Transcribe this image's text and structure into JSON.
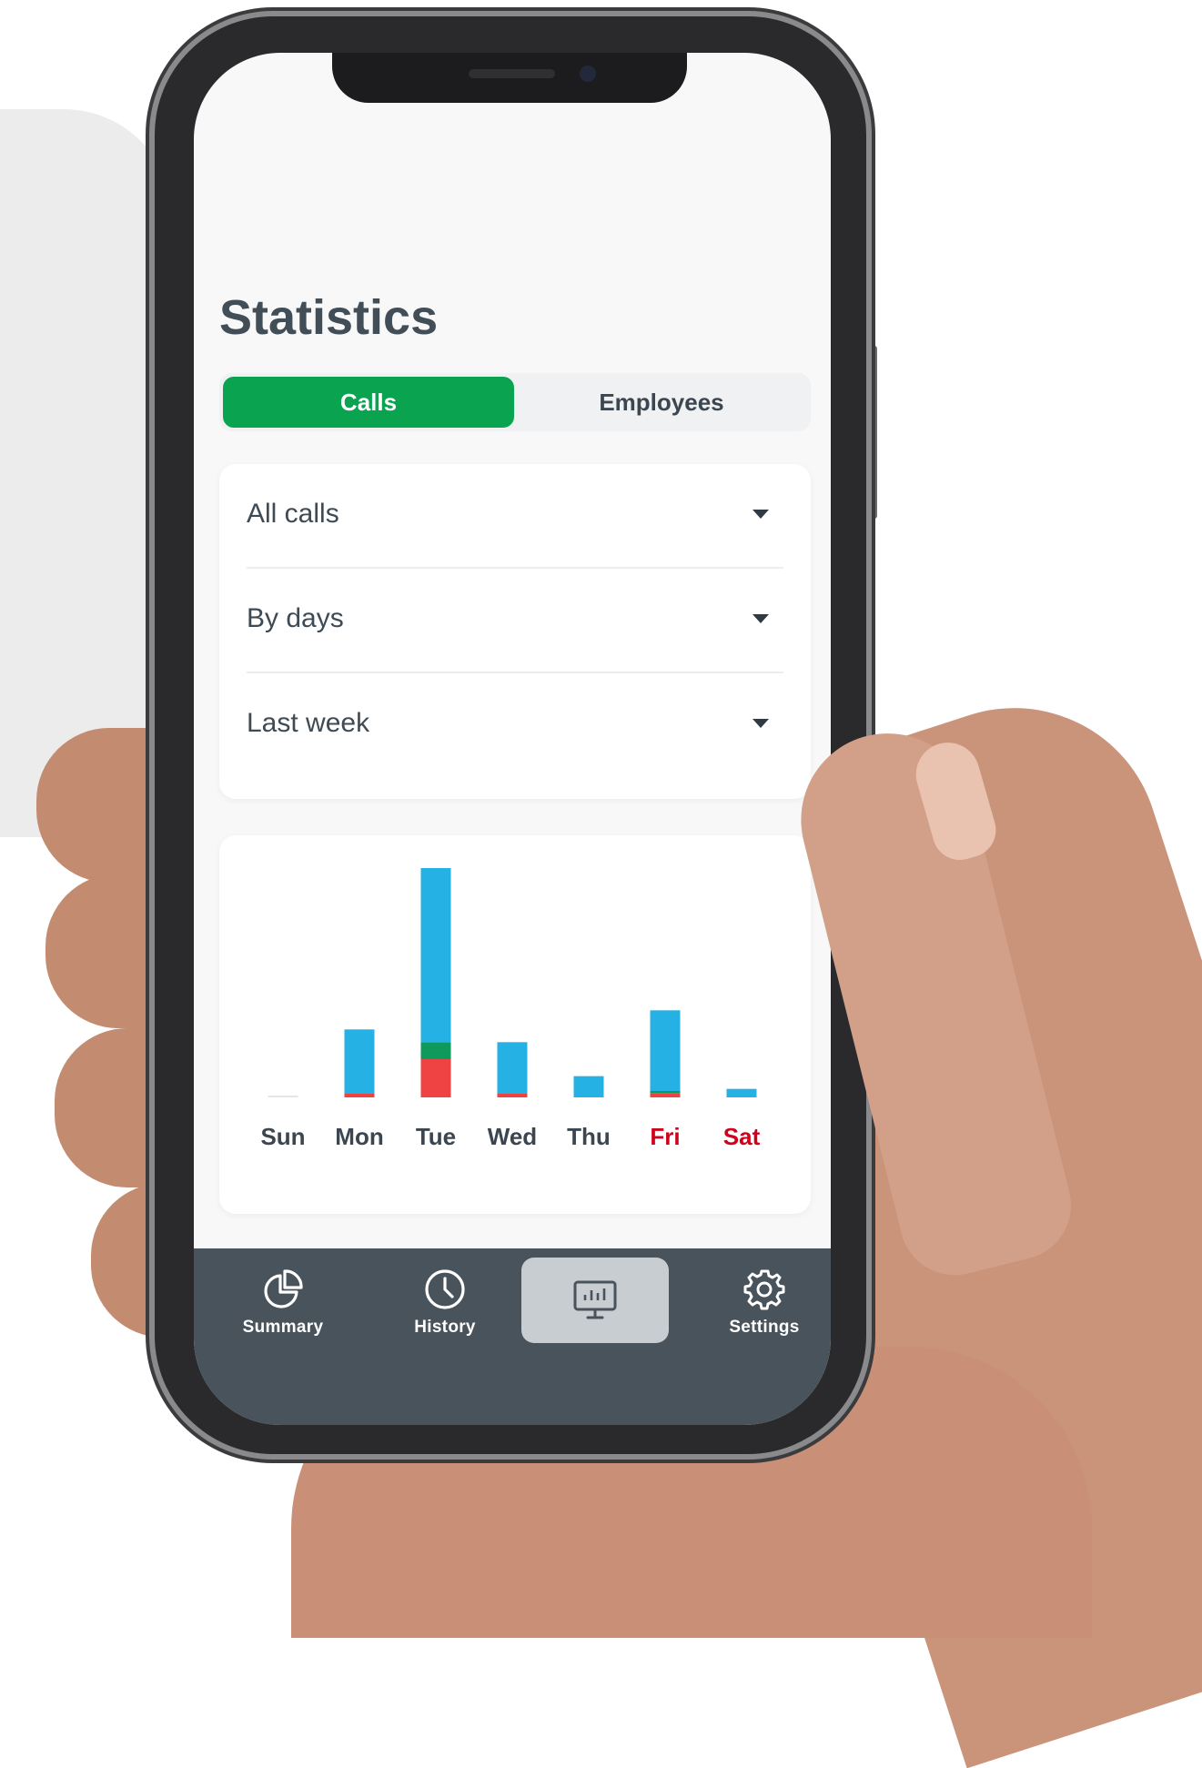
{
  "page": {
    "title": "Statistics"
  },
  "segmented": {
    "calls": "Calls",
    "employees": "Employees",
    "active": "calls"
  },
  "filters": {
    "type": "All calls",
    "grouping": "By days",
    "period": "Last week"
  },
  "chart_data": {
    "type": "bar",
    "stacked": true,
    "categories": [
      "Sun",
      "Mon",
      "Tue",
      "Wed",
      "Thu",
      "Fri",
      "Sat"
    ],
    "weekend_color": "#d0021b",
    "weekday_color": "#3b4650",
    "weekend_categories": [
      "Fri",
      "Sat"
    ],
    "series": [
      {
        "color": "#ef4343",
        "values": [
          0,
          1,
          9,
          1,
          0,
          1,
          0
        ]
      },
      {
        "color": "#0e9a5a",
        "values": [
          0,
          0,
          4,
          0,
          0,
          0.5,
          0
        ]
      },
      {
        "color": "#25b1e3",
        "values": [
          0,
          15,
          41,
          12,
          5,
          19,
          2
        ]
      }
    ],
    "ylim": [
      0,
      54
    ],
    "grid": false,
    "legend": "none"
  },
  "tabbar": {
    "items": [
      {
        "label": "Summary",
        "icon": "pie-chart-icon"
      },
      {
        "label": "History",
        "icon": "clock-icon"
      },
      {
        "label": "",
        "icon": "statistics-monitor-icon",
        "active": true
      },
      {
        "label": "Settings",
        "icon": "gear-icon"
      }
    ],
    "active_bg": "#c8cdd1",
    "bar_bg": "#48535b"
  },
  "colors": {
    "accent": "#0aa34f",
    "title": "#414d57"
  }
}
